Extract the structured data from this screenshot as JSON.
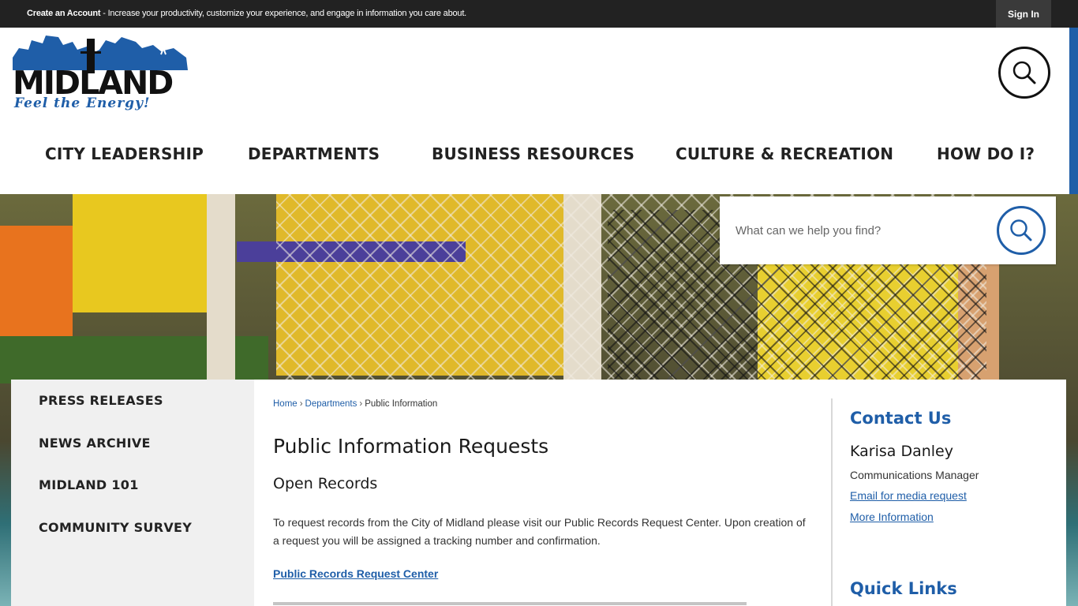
{
  "topbar": {
    "create_account": "Create an Account",
    "message": " - Increase your productivity, customize your experience, and engage in information you care about.",
    "sign_in": "Sign In"
  },
  "logo": {
    "word": "MIDLAND",
    "tagline": "Feel the Energy!"
  },
  "nav": {
    "items": [
      "CITY LEADERSHIP",
      "DEPARTMENTS",
      "BUSINESS RESOURCES",
      "CULTURE & RECREATION",
      "HOW DO I?"
    ]
  },
  "search": {
    "placeholder": "What can we help you find?"
  },
  "sidebar": {
    "items": [
      "PRESS RELEASES",
      "NEWS ARCHIVE",
      "MIDLAND 101",
      "COMMUNITY SURVEY"
    ]
  },
  "breadcrumb": {
    "home": "Home",
    "departments": "Departments",
    "current": "Public Information"
  },
  "main": {
    "title": "Public Information Requests",
    "subtitle": "Open Records",
    "paragraph": "To request records from the City of Midland please visit our Public Records Request Center. Upon creation of a request you will be assigned a tracking number and confirmation.",
    "link": "Public Records Request Center"
  },
  "contact": {
    "title": "Contact Us",
    "name": "Karisa Danley",
    "role": "Communications Manager",
    "email_link": "Email for media request",
    "more_link": "More Information"
  },
  "quick_links": {
    "title": "Quick Links"
  },
  "colors": {
    "brand_blue": "#1f5ea8",
    "topbar": "#222222",
    "sidebar_bg": "#f0f0f0"
  }
}
